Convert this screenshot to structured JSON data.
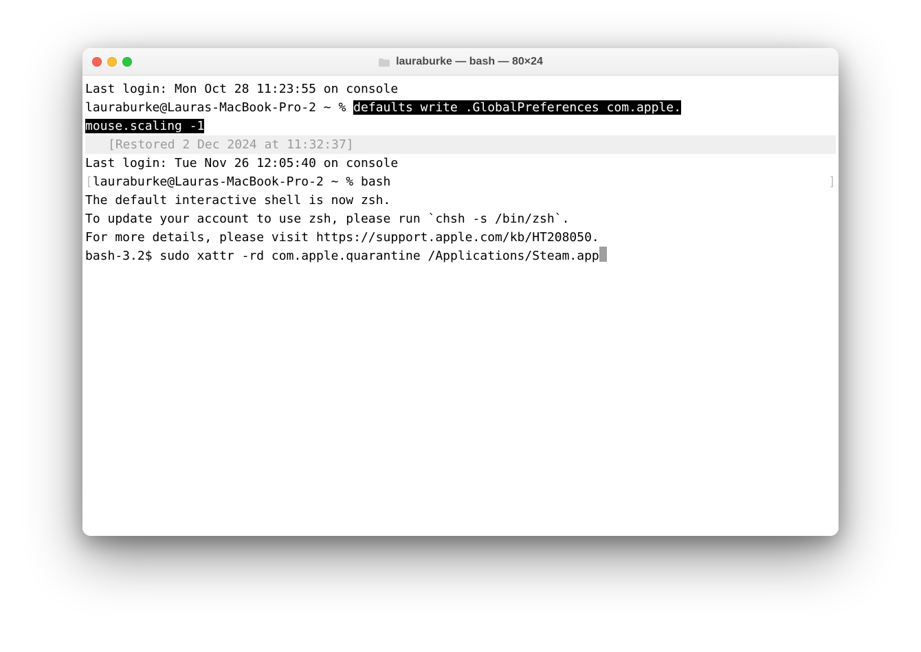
{
  "window": {
    "title": "lauraburke — bash — 80×24",
    "traffic_lights": {
      "close": "close",
      "minimize": "minimize",
      "zoom": "zoom"
    }
  },
  "terminal": {
    "line1": "Last login: Mon Oct 28 11:23:55 on console",
    "prompt1": "lauraburke@Lauras-MacBook-Pro-2 ~ % ",
    "cmd1_part1": "defaults write .GlobalPreferences com.apple.",
    "cmd1_part2": "mouse.scaling -1",
    "restored": "[Restored 2 Dec 2024 at 11:32:37]",
    "line2": "Last login: Tue Nov 26 12:05:40 on console",
    "prompt2_open": "[",
    "prompt2": "lauraburke@Lauras-MacBook-Pro-2 ~ % ",
    "cmd2": "bash",
    "prompt2_close": "]",
    "blank": "",
    "zsh1": "The default interactive shell is now zsh.",
    "zsh2": "To update your account to use zsh, please run `chsh -s /bin/zsh`.",
    "zsh3": "For more details, please visit https://support.apple.com/kb/HT208050.",
    "bash_prompt": "bash-3.2$ ",
    "bash_cmd": "sudo xattr -rd com.apple.quarantine /Applications/Steam.app"
  }
}
